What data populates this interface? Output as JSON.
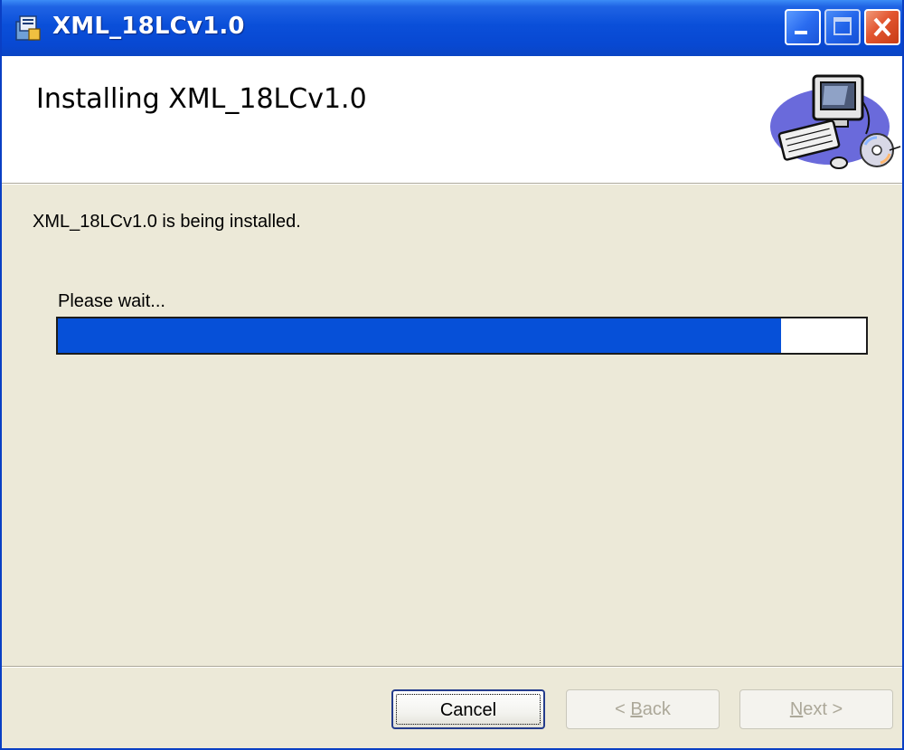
{
  "window": {
    "title": "XML_18LCv1.0"
  },
  "header": {
    "title": "Installing XML_18LCv1.0"
  },
  "main": {
    "status": "XML_18LCv1.0 is being installed.",
    "wait_label": "Please wait...",
    "progress_fraction": 0.895
  },
  "buttons": {
    "cancel": "Cancel",
    "back_prefix": "< ",
    "back_mnemonic": "B",
    "back_rest": "ack",
    "next_mnemonic": "N",
    "next_rest": "ext >"
  },
  "colors": {
    "titlebar": "#0a4fd9",
    "progress_fill": "#0650d8",
    "dialog_bg": "#ece9d8"
  }
}
